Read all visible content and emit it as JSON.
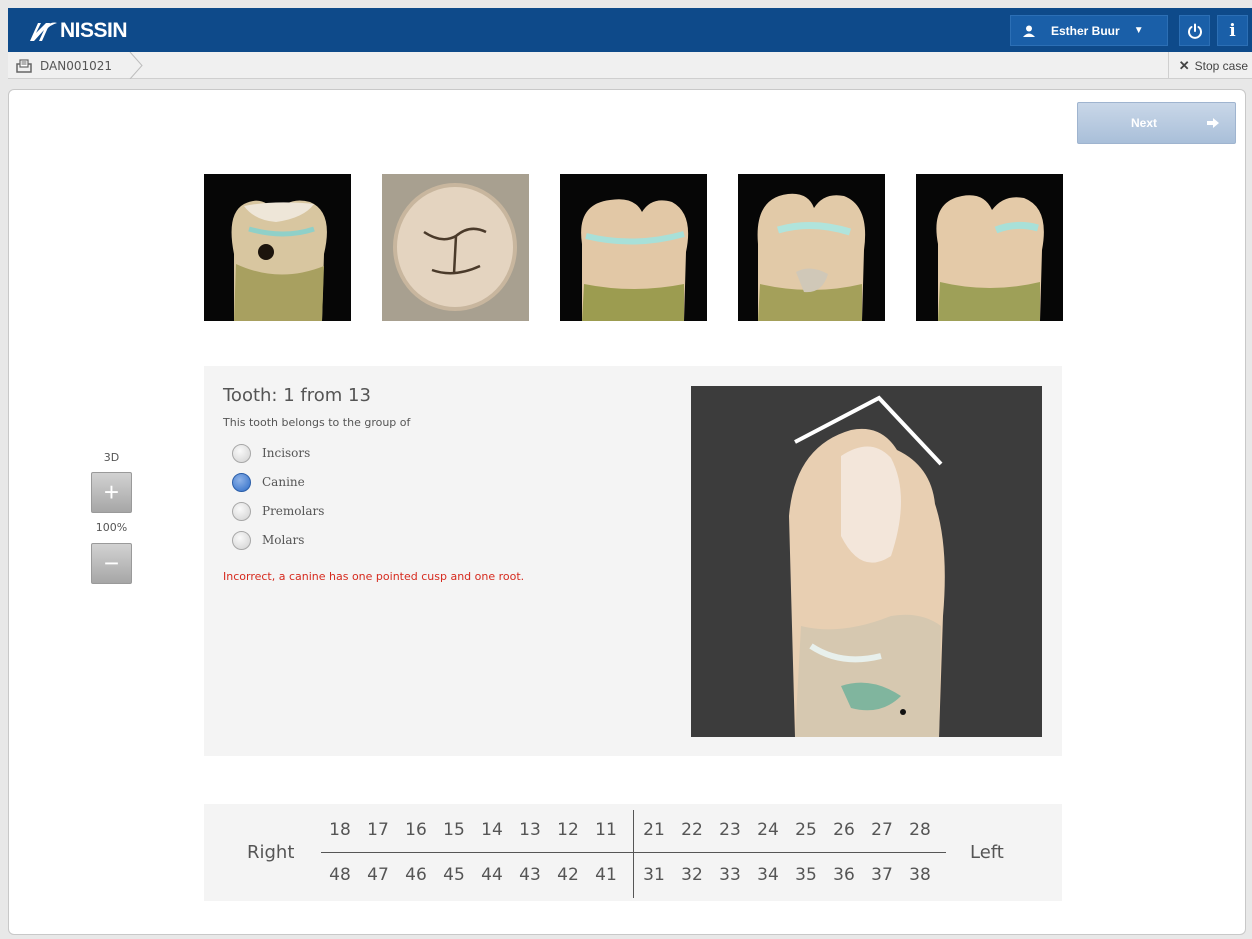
{
  "header": {
    "brand": "NISSIN",
    "user_name": "Esther Buur",
    "colors": {
      "bar": "#0e4a8a",
      "accent": "#2d6cc7",
      "error": "#d62a1e"
    }
  },
  "breadcrumb": {
    "case_id": "DAN001021",
    "stop_label": "Stop case"
  },
  "toolbar": {
    "next_label": "Next"
  },
  "zoom": {
    "mode_label": "3D",
    "level": "100%"
  },
  "thumbnails": [
    {
      "icon": "tooth-photo-1"
    },
    {
      "icon": "tooth-photo-2"
    },
    {
      "icon": "tooth-photo-3"
    },
    {
      "icon": "tooth-photo-4"
    },
    {
      "icon": "tooth-photo-5"
    }
  ],
  "question": {
    "title": "Tooth: 1 from 13",
    "prompt": "This tooth belongs to the group of",
    "options": [
      {
        "label": "Incisors",
        "selected": false
      },
      {
        "label": "Canine",
        "selected": true
      },
      {
        "label": "Premolars",
        "selected": false
      },
      {
        "label": "Molars",
        "selected": false
      }
    ],
    "feedback": "Incorrect, a canine has one pointed cusp and one root."
  },
  "tooth_chart": {
    "right_label": "Right",
    "left_label": "Left",
    "upper_right": [
      "18",
      "17",
      "16",
      "15",
      "14",
      "13",
      "12",
      "11"
    ],
    "upper_left": [
      "21",
      "22",
      "23",
      "24",
      "25",
      "26",
      "27",
      "28"
    ],
    "lower_right": [
      "48",
      "47",
      "46",
      "45",
      "44",
      "43",
      "42",
      "41"
    ],
    "lower_left": [
      "31",
      "32",
      "33",
      "34",
      "35",
      "36",
      "37",
      "38"
    ]
  }
}
